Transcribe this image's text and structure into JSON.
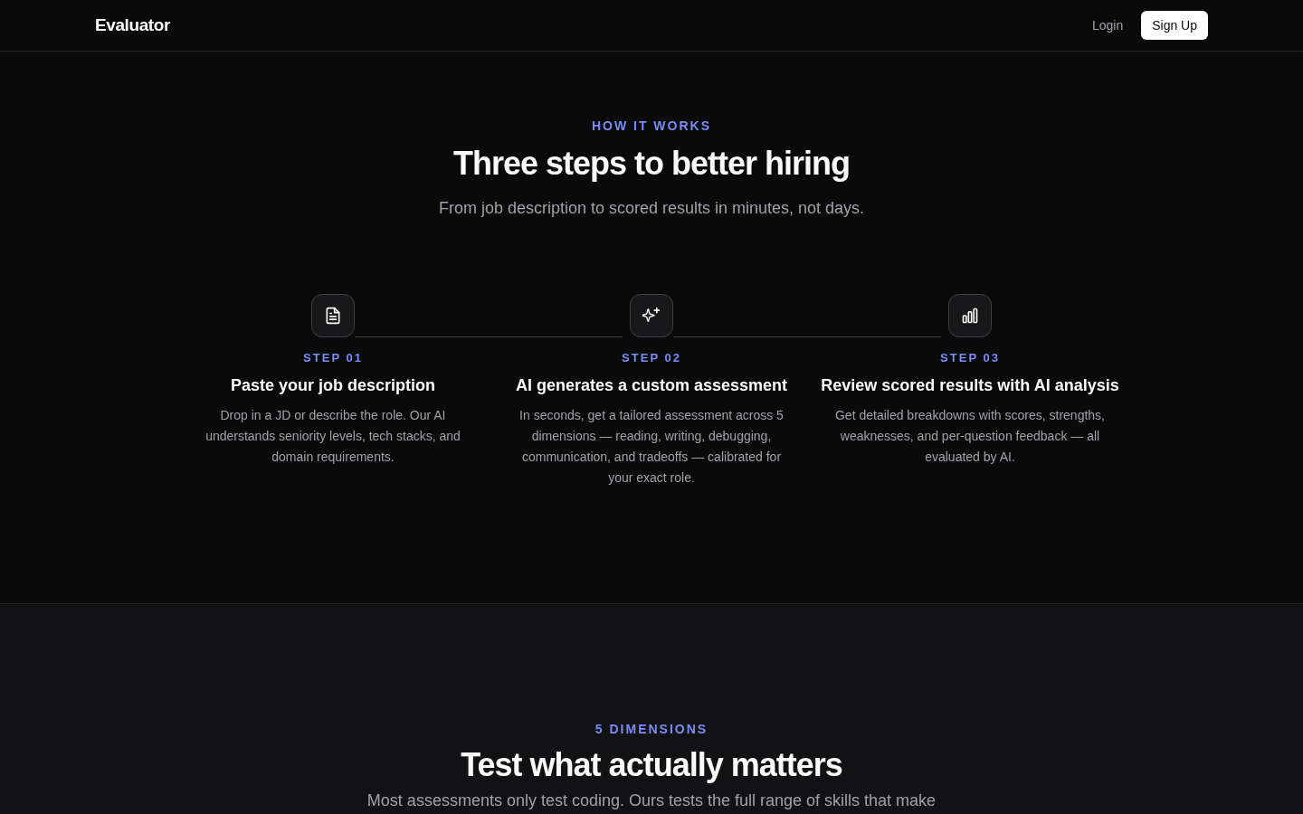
{
  "nav": {
    "logo": "Evaluator",
    "actions": [
      {
        "label": "Login",
        "kind": "link"
      },
      {
        "label": "Sign Up",
        "kind": "primary"
      }
    ]
  },
  "how_it_works": {
    "eyebrow": "HOW IT WORKS",
    "title": "Three steps to better hiring",
    "subtitle": "From job description to scored results in minutes, not days.",
    "steps": [
      {
        "number": "STEP 01",
        "title": "Paste your job description",
        "description": "Drop in a JD or describe the role. Our AI understands seniority levels, tech stacks, and domain requirements."
      },
      {
        "number": "STEP 02",
        "title": "AI generates a custom assessment",
        "description": "In seconds, get a tailored assessment across 5 dimensions — reading, writing, debugging, communication, and tradeoffs — calibrated for your exact role."
      },
      {
        "number": "STEP 03",
        "title": "Review scored results with AI analysis",
        "description": "Get detailed breakdowns with scores, strengths, weaknesses, and per-question feedback — all evaluated by AI."
      }
    ]
  },
  "dimensions": {
    "eyebrow": "5 DIMENSIONS",
    "title": "Test what actually matters",
    "subtitle": "Most assessments only test coding. Ours tests the full range of skills that make"
  }
}
